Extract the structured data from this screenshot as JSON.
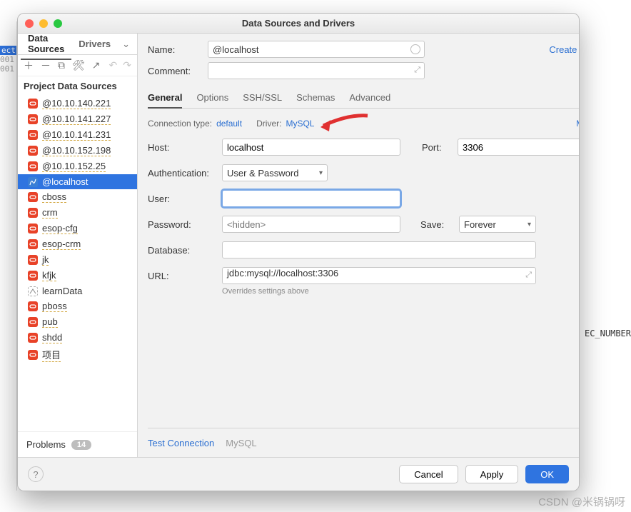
{
  "bg": {
    "sel_text": "ect",
    "gutter": [
      "001",
      "001"
    ],
    "right_text": "EC_NUMBER"
  },
  "dialog": {
    "title": "Data Sources and Drivers",
    "side_tabs": {
      "data_sources": "Data Sources",
      "drivers": "Drivers"
    },
    "section": "Project Data Sources",
    "items": [
      {
        "label": "@10.10.140.221",
        "variant": "or",
        "dashed": true
      },
      {
        "label": "@10.10.141.227",
        "variant": "or",
        "dashed": true
      },
      {
        "label": "@10.10.141.231",
        "variant": "or",
        "dashed": true
      },
      {
        "label": "@10.10.152.198",
        "variant": "or",
        "dashed": true
      },
      {
        "label": "@10.10.152.25",
        "variant": "or",
        "dashed": true
      },
      {
        "label": "@localhost",
        "variant": "bl",
        "selected": true
      },
      {
        "label": "cboss",
        "variant": "or",
        "dashed": true
      },
      {
        "label": "crm",
        "variant": "or",
        "dashed": true
      },
      {
        "label": "esop-cfg",
        "variant": "or",
        "dashed": true
      },
      {
        "label": "esop-crm",
        "variant": "or",
        "dashed": true
      },
      {
        "label": "jk",
        "variant": "or",
        "dashed": true
      },
      {
        "label": "kfjk",
        "variant": "or",
        "dashed": true
      },
      {
        "label": "learnData",
        "variant": "lt"
      },
      {
        "label": "pboss",
        "variant": "or",
        "dashed": true
      },
      {
        "label": "pub",
        "variant": "or",
        "dashed": true
      },
      {
        "label": "shdd",
        "variant": "or",
        "dashed": true
      },
      {
        "label": "项目",
        "variant": "or",
        "dashed": true
      }
    ],
    "problems": {
      "label": "Problems",
      "count": "14"
    }
  },
  "form": {
    "name_label": "Name:",
    "name_value": "@localhost",
    "create_ddl": "Create DDL Mapping",
    "comment_label": "Comment:",
    "tabs": [
      "General",
      "Options",
      "SSH/SSL",
      "Schemas",
      "Advanced"
    ],
    "conn_type_label": "Connection type:",
    "conn_type_value": "default",
    "driver_label": "Driver:",
    "driver_value": "MySQL",
    "more_options": "More Options",
    "host_label": "Host:",
    "host_value": "localhost",
    "port_label": "Port:",
    "port_value": "3306",
    "auth_label": "Authentication:",
    "auth_value": "User & Password",
    "user_label": "User:",
    "user_value": "",
    "pw_label": "Password:",
    "pw_placeholder": "<hidden>",
    "save_label": "Save:",
    "save_value": "Forever",
    "db_label": "Database:",
    "db_value": "",
    "url_label": "URL:",
    "url_value": "jdbc:mysql://localhost:3306",
    "override": "Overrides settings above",
    "test_conn": "Test Connection",
    "driver_name": "MySQL"
  },
  "buttons": {
    "cancel": "Cancel",
    "apply": "Apply",
    "ok": "OK",
    "help": "?"
  },
  "watermark": "CSDN @米锅锅呀"
}
